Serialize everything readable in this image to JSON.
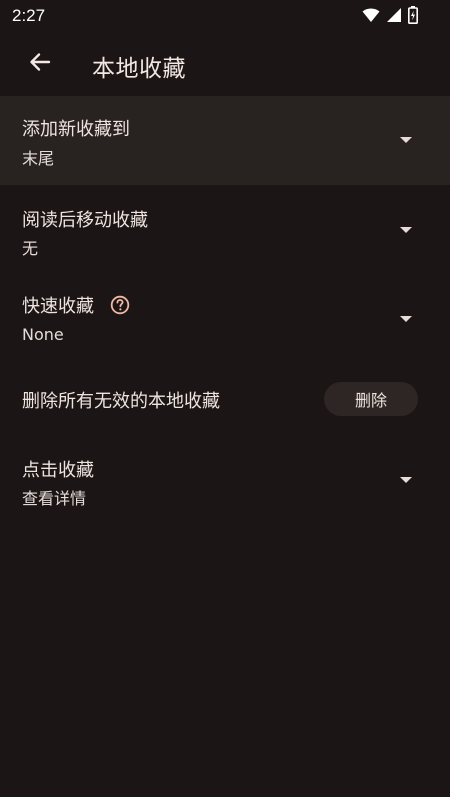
{
  "status_bar": {
    "time": "2:27",
    "icons": [
      "wifi-icon",
      "cell-signal-icon",
      "battery-charging-icon"
    ]
  },
  "app_bar": {
    "title": "本地收藏",
    "back_icon": "arrow-back-icon"
  },
  "settings": [
    {
      "id": "add-new-to",
      "title": "添加新收藏到",
      "value": "末尾",
      "has_dropdown": true,
      "highlighted": true
    },
    {
      "id": "move-after-read",
      "title": "阅读后移动收藏",
      "value": "无",
      "has_dropdown": true,
      "highlighted": false
    },
    {
      "id": "quick-favorite",
      "title": "快速收藏",
      "value": "None",
      "has_dropdown": true,
      "has_help": true,
      "highlighted": false
    },
    {
      "id": "delete-invalid",
      "title": "删除所有无效的本地收藏",
      "button_label": "删除"
    },
    {
      "id": "click-favorite",
      "title": "点击收藏",
      "value": "查看详情",
      "has_dropdown": true,
      "highlighted": false
    }
  ],
  "colors": {
    "background": "#1b1615",
    "highlight": "#282221",
    "help_icon": "#f0b8a5",
    "button_bg": "#2d2624"
  }
}
